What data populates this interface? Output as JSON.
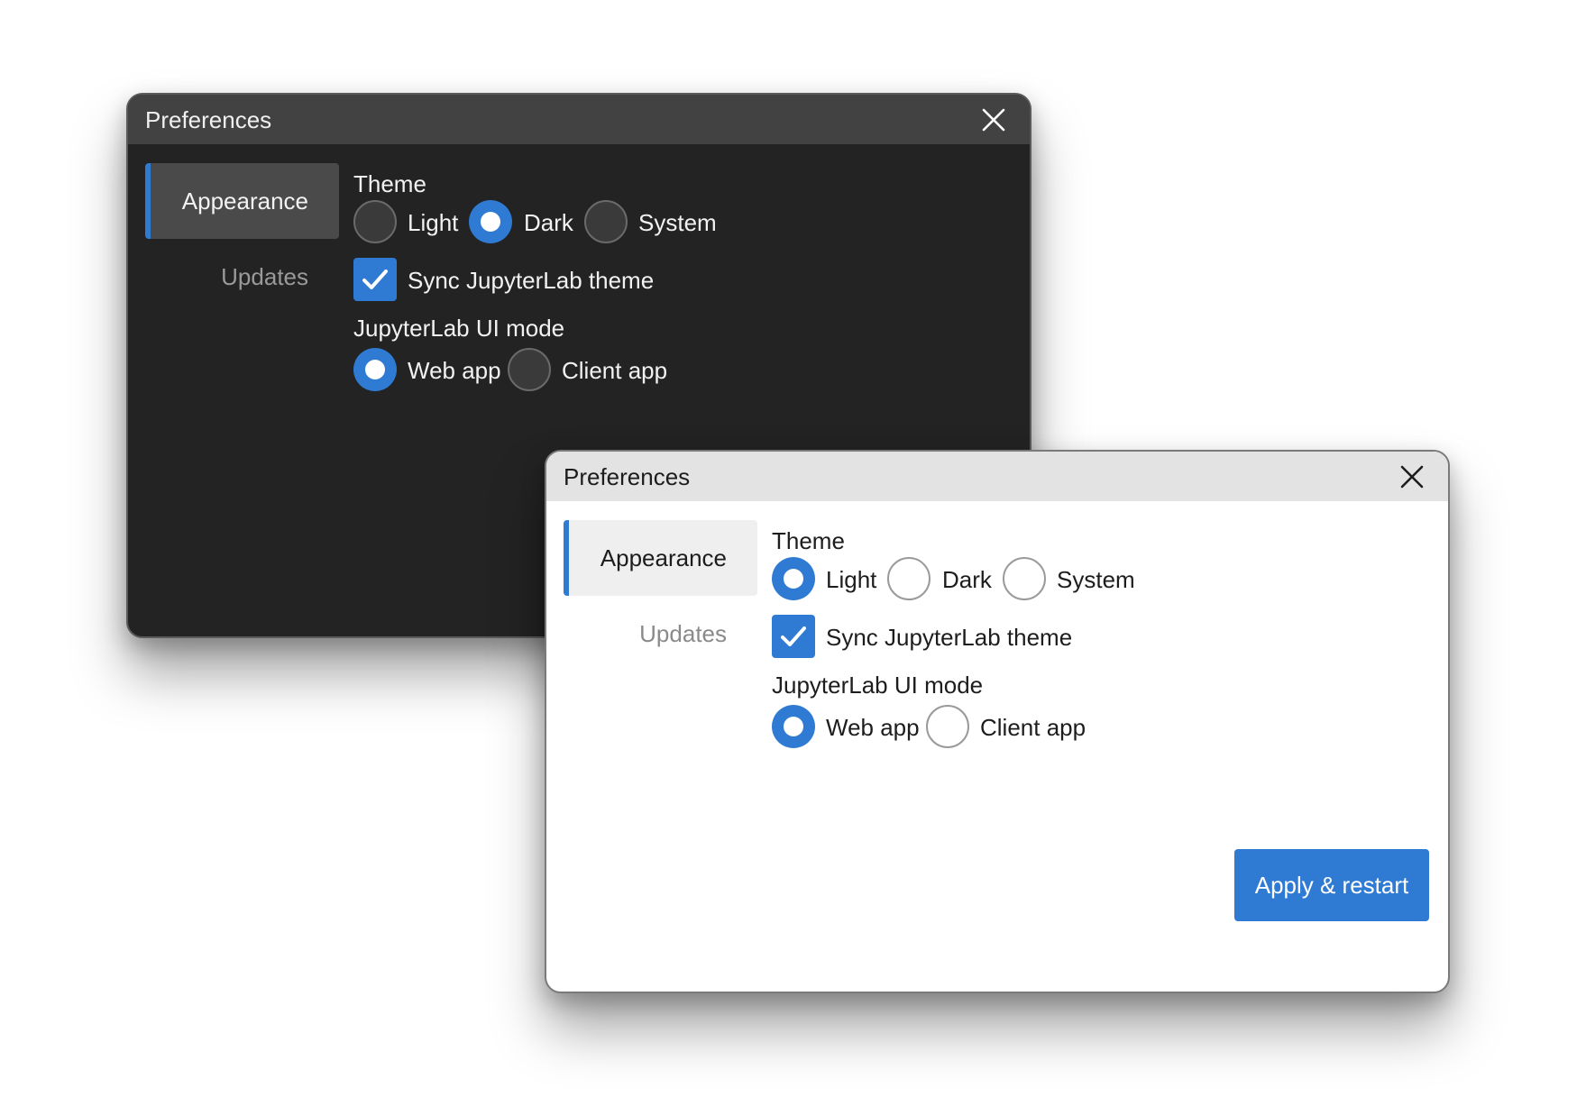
{
  "dark_window": {
    "title": "Preferences",
    "nav": {
      "appearance": "Appearance",
      "updates": "Updates"
    },
    "theme_label": "Theme",
    "theme_options": [
      "Light",
      "Dark",
      "System"
    ],
    "theme_selected": "Dark",
    "sync_label": "Sync JupyterLab theme",
    "sync_checked": true,
    "ui_mode_label": "JupyterLab UI mode",
    "ui_mode_options": [
      "Web app",
      "Client app"
    ],
    "ui_mode_selected": "Web app"
  },
  "light_window": {
    "title": "Preferences",
    "nav": {
      "appearance": "Appearance",
      "updates": "Updates"
    },
    "theme_label": "Theme",
    "theme_options": [
      "Light",
      "Dark",
      "System"
    ],
    "theme_selected": "Light",
    "sync_label": "Sync JupyterLab theme",
    "sync_checked": true,
    "ui_mode_label": "JupyterLab UI mode",
    "ui_mode_options": [
      "Web app",
      "Client app"
    ],
    "ui_mode_selected": "Web app",
    "apply_button": "Apply & restart"
  },
  "colors": {
    "accent": "#2f7ad3",
    "dark_bg": "#232323",
    "dark_titlebar": "#424242",
    "light_bg": "#ffffff",
    "light_titlebar": "#e3e3e3"
  },
  "icons": {
    "close": "close-icon",
    "check": "check-icon"
  }
}
